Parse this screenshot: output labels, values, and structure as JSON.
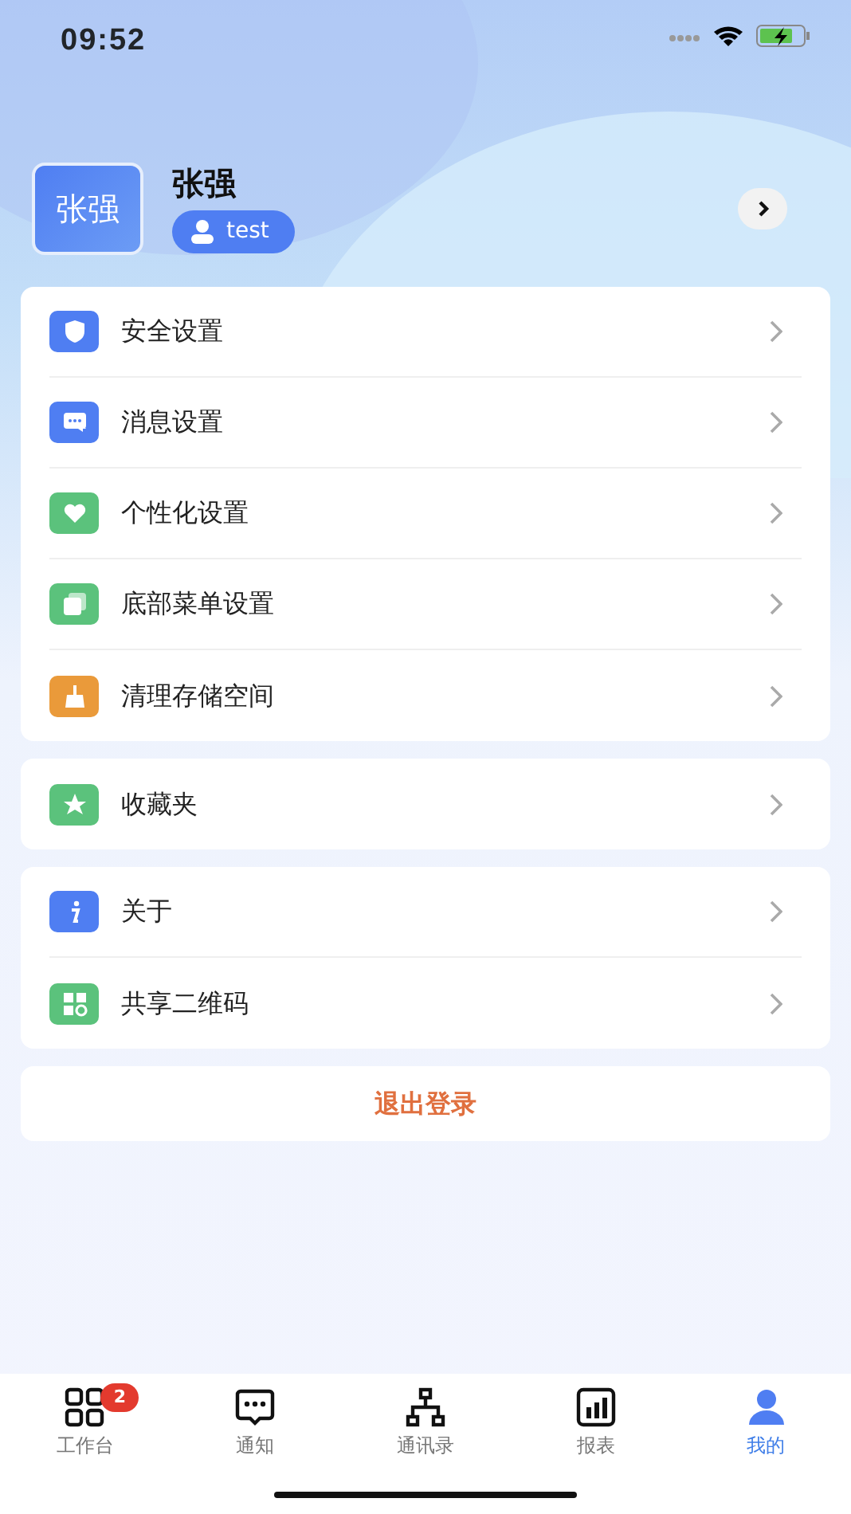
{
  "status_bar": {
    "time": "09:52"
  },
  "profile": {
    "avatar_text": "张强",
    "name": "张强",
    "username": "test"
  },
  "groups": [
    {
      "items": [
        {
          "label": "安全设置",
          "kind": "shield",
          "color": "#4f7ef2"
        },
        {
          "label": "消息设置",
          "kind": "chat",
          "color": "#4f7ef2"
        },
        {
          "label": "个性化设置",
          "kind": "heart",
          "color": "#5bc27c"
        },
        {
          "label": "底部菜单设置",
          "kind": "layers",
          "color": "#5bc27c"
        },
        {
          "label": "清理存储空间",
          "kind": "broom",
          "color": "#ea9a3a"
        }
      ]
    },
    {
      "items": [
        {
          "label": "收藏夹",
          "kind": "star",
          "color": "#5bc27c"
        }
      ]
    },
    {
      "items": [
        {
          "label": "关于",
          "kind": "info",
          "color": "#4f7ef2"
        },
        {
          "label": "共享二维码",
          "kind": "qr",
          "color": "#5bc27c"
        }
      ]
    }
  ],
  "logout": {
    "label": "退出登录"
  },
  "tabs": [
    {
      "label": "工作台",
      "kind": "grid",
      "selected": false,
      "badge": "2"
    },
    {
      "label": "通知",
      "kind": "chat",
      "selected": false
    },
    {
      "label": "通讯录",
      "kind": "org",
      "selected": false
    },
    {
      "label": "报表",
      "kind": "chart",
      "selected": false
    },
    {
      "label": "我的",
      "kind": "person",
      "selected": true
    }
  ]
}
